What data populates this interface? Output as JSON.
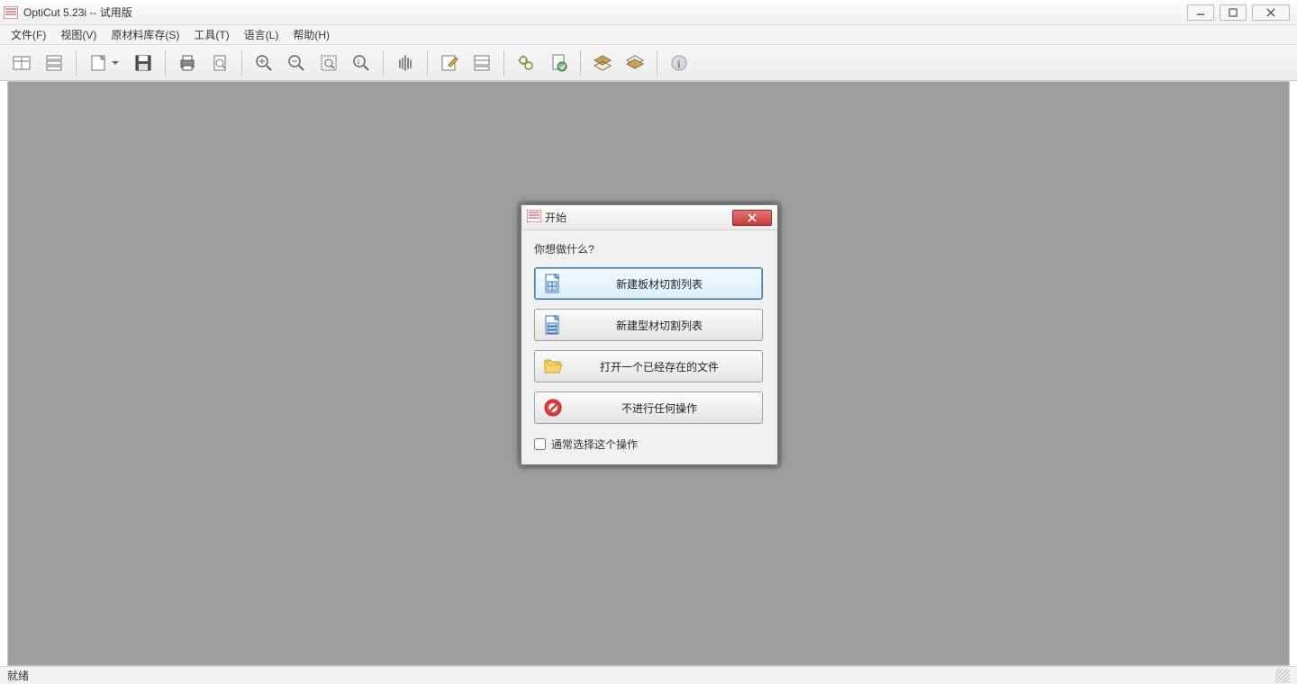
{
  "window": {
    "title": "OptiCut 5.23i -- 试用版"
  },
  "menu": {
    "file": "文件(F)",
    "view": "视图(V)",
    "stock": "原材料库存(S)",
    "tools": "工具(T)",
    "language": "语言(L)",
    "help": "帮助(H)"
  },
  "status": {
    "ready": "就绪"
  },
  "dialog": {
    "title": "开始",
    "prompt": "你想做什么?",
    "option1": "新建板材切割列表",
    "option2": "新建型材切割列表",
    "option3": "打开一个已经存在的文件",
    "option4": "不进行任何操作",
    "checkbox": "通常选择这个操作"
  }
}
